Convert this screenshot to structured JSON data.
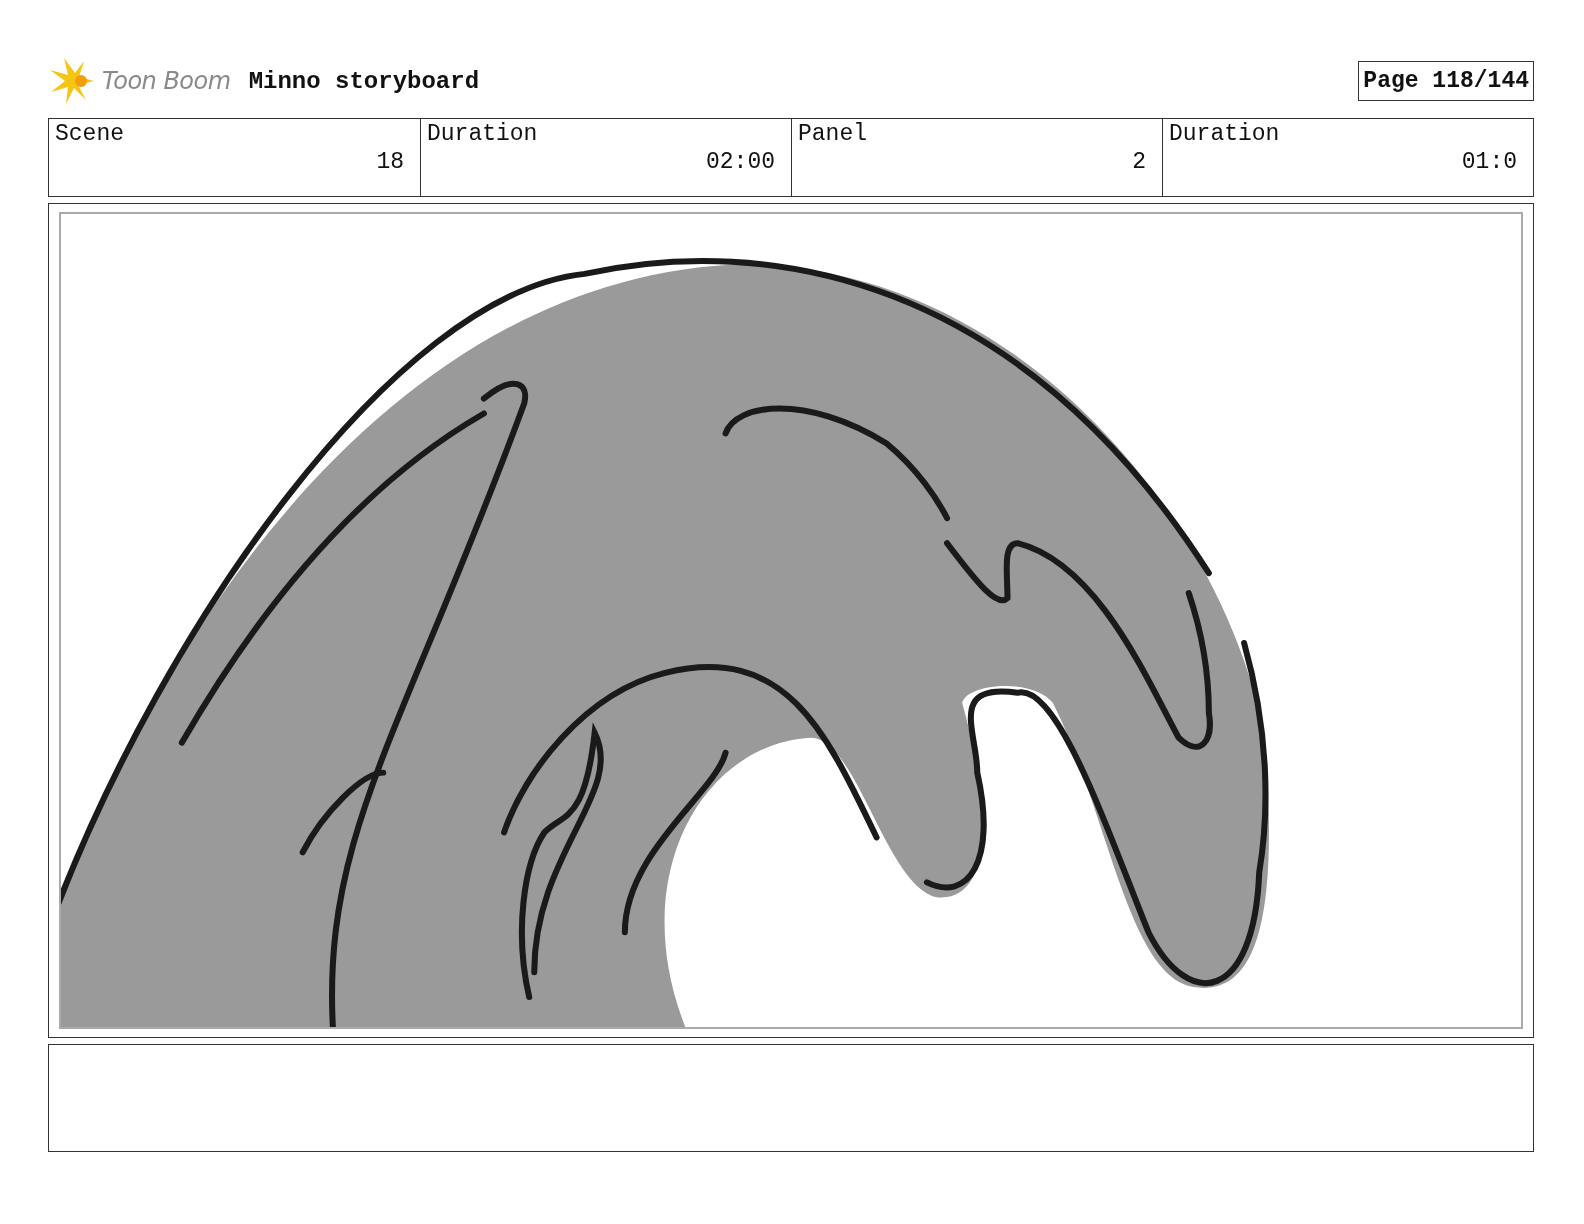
{
  "header": {
    "logo_text": "Toon Boom",
    "title": "Minno storyboard",
    "page": "Page 118/144"
  },
  "info": [
    {
      "label": "Scene",
      "value": "18"
    },
    {
      "label": "Duration",
      "value": "02:00"
    },
    {
      "label": "Panel",
      "value": "2"
    },
    {
      "label": "Duration",
      "value": "01:0"
    }
  ],
  "panel": {
    "kind": "drawing"
  }
}
